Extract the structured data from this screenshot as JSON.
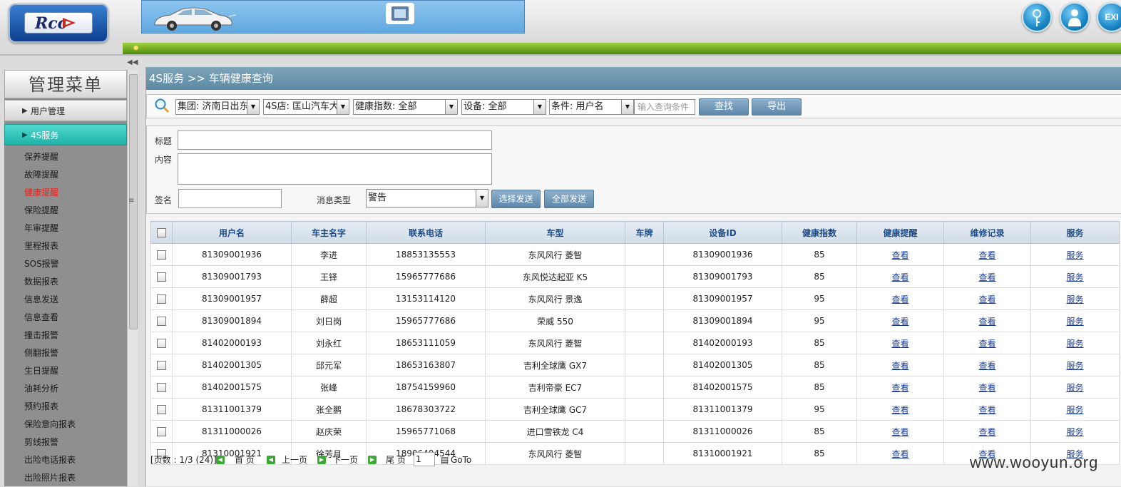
{
  "header": {
    "logo_text": "Rcc",
    "buttons": [
      {
        "name": "key",
        "label": ""
      },
      {
        "name": "user",
        "label": ""
      },
      {
        "name": "exit",
        "label": "EXI"
      }
    ]
  },
  "sidebar": {
    "title": "管理菜单",
    "groups": [
      {
        "label": "用户管理"
      },
      {
        "label": "4S服务"
      }
    ],
    "items": [
      {
        "label": "保养提醒"
      },
      {
        "label": "故障提醒"
      },
      {
        "label": "健康提醒",
        "active": true
      },
      {
        "label": "保险提醒"
      },
      {
        "label": "年审提醒"
      },
      {
        "label": "里程报表"
      },
      {
        "label": "SOS报警"
      },
      {
        "label": "数据报表"
      },
      {
        "label": "信息发送"
      },
      {
        "label": "信息查看"
      },
      {
        "label": "撞击报警"
      },
      {
        "label": "侧翻报警"
      },
      {
        "label": "生日提醒"
      },
      {
        "label": "油耗分析"
      },
      {
        "label": "预约报表"
      },
      {
        "label": "保险意向报表"
      },
      {
        "label": "剪线报警"
      },
      {
        "label": "出险电话报表"
      },
      {
        "label": "出险照片报表"
      }
    ]
  },
  "breadcrumb": "4S服务 >> 车辆健康查询",
  "search": {
    "group": "集团: 济南日出东",
    "store": "4S店: 匡山汽车大",
    "health": "健康指数: 全部",
    "device": "设备: 全部",
    "condition": "条件: 用户名",
    "query_placeholder": "输入查询条件",
    "find_label": "查找",
    "export_label": "导出"
  },
  "message": {
    "title_label": "标题",
    "content_label": "内容",
    "sign_label": "签名",
    "type_label": "消息类型",
    "type_value": "警告",
    "send_selected": "选择发送",
    "send_all": "全部发送"
  },
  "table": {
    "headers": [
      "用户名",
      "车主名字",
      "联系电话",
      "车型",
      "车牌",
      "设备ID",
      "健康指数",
      "健康提醒",
      "维修记录",
      "服务"
    ],
    "rows": [
      [
        "81309001936",
        "李进",
        "18853135553",
        "东风风行 菱智",
        "",
        "81309001936",
        "85",
        "查看",
        "查看",
        "服务"
      ],
      [
        "81309001793",
        "王铎",
        "15965777686",
        "东风悦达起亚 K5",
        "",
        "81309001793",
        "85",
        "查看",
        "查看",
        "服务"
      ],
      [
        "81309001957",
        "薛超",
        "13153114120",
        "东风风行 景逸",
        "",
        "81309001957",
        "95",
        "查看",
        "查看",
        "服务"
      ],
      [
        "81309001894",
        "刘日岗",
        "15965777686",
        "荣威 550",
        "",
        "81309001894",
        "95",
        "查看",
        "查看",
        "服务"
      ],
      [
        "81402000193",
        "刘永红",
        "18653111059",
        "东风风行 菱智",
        "",
        "81402000193",
        "85",
        "查看",
        "查看",
        "服务"
      ],
      [
        "81402001305",
        "邱元军",
        "18653163807",
        "吉利全球鹰 GX7",
        "",
        "81402001305",
        "85",
        "查看",
        "查看",
        "服务"
      ],
      [
        "81402001575",
        "张峰",
        "18754159960",
        "吉利帝豪 EC7",
        "",
        "81402001575",
        "85",
        "查看",
        "查看",
        "服务"
      ],
      [
        "81311001379",
        "张全鹏",
        "18678303722",
        "吉利全球鹰 GC7",
        "",
        "81311001379",
        "95",
        "查看",
        "查看",
        "服务"
      ],
      [
        "81311000026",
        "赵庆荣",
        "15965771068",
        "进口雪铁龙 C4",
        "",
        "81311000026",
        "85",
        "查看",
        "查看",
        "服务"
      ],
      [
        "81310001921",
        "徐芳月",
        "18906404544",
        "东风风行 菱智",
        "",
        "81310001921",
        "85",
        "查看",
        "查看",
        "服务"
      ]
    ]
  },
  "pager": {
    "info": "[页数 : 1/3 (24)]",
    "first": "首 页",
    "prev": "上一页",
    "next": "下一页",
    "last": "尾 页",
    "page_value": "1",
    "goto": "GoTo"
  },
  "watermark": "www.wooyun.org"
}
